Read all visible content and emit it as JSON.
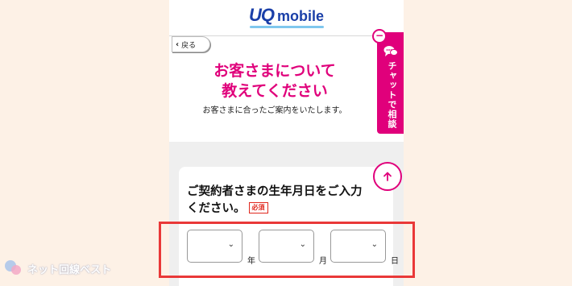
{
  "header": {
    "logo_uq": "UQ",
    "logo_mobile": "mobile",
    "back_label": "戻る"
  },
  "intro": {
    "title_line1": "お客さまについて",
    "title_line2": "教えてください",
    "subtitle": "お客さまに合ったご案内をいたします。"
  },
  "chat": {
    "label": "チャットで相談",
    "collapse_symbol": "−"
  },
  "form": {
    "heading_line1": "ご契約者さまの生年月日をご入力",
    "heading_line2": "ください。",
    "required_badge": "必須",
    "dob": {
      "year_unit": "年",
      "month_unit": "月",
      "day_unit": "日",
      "year_value": "",
      "month_value": "",
      "day_value": ""
    }
  },
  "watermark": {
    "text": "ネット回線ベスト"
  },
  "colors": {
    "brand_pink": "#e0007b",
    "logo_blue": "#1a3fa8",
    "highlight_red": "#e93838",
    "background": "#fdf1e6"
  }
}
